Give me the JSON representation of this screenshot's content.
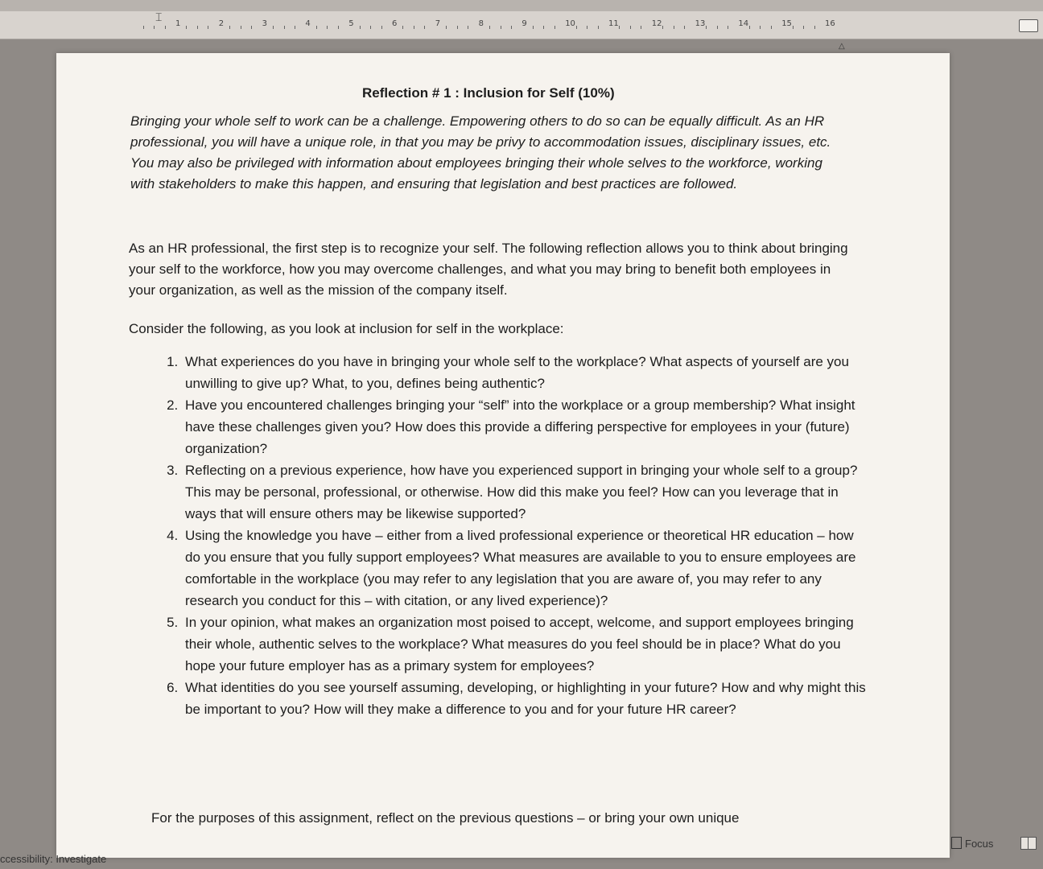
{
  "ruler": {
    "numbers": [
      "1",
      "2",
      "3",
      "4",
      "5",
      "6",
      "7",
      "8",
      "9",
      "10",
      "11",
      "12",
      "13",
      "14",
      "15",
      "16"
    ]
  },
  "document": {
    "title": "Reflection # 1 : Inclusion for Self (10%)",
    "intro_italic": "Bringing your whole self to work can be a challenge. Empowering others to do so can be equally difficult. As an HR professional, you will have a unique role, in that you may be privy to accommodation issues, disciplinary issues, etc. You may also be privileged with information about employees bringing their whole selves to the workforce, working with stakeholders to make this happen, and ensuring that legislation and best practices are followed.",
    "para1": "As an HR professional, the first step is to recognize your self. The following reflection allows you to think about bringing your self to the workforce, how you may overcome challenges, and what you may bring to benefit both employees in your organization, as well as the mission of the company itself.",
    "para2": "Consider the following, as you look at inclusion for self in the workplace:",
    "questions": [
      "What experiences do you have in bringing your whole self to the workplace? What aspects of yourself are you unwilling to give up? What, to you, defines being authentic?",
      "Have you encountered challenges bringing your “self” into the workplace or a group membership? What insight have these challenges given you? How does this provide a differing perspective for employees in your (future) organization?",
      "Reflecting on a previous experience, how have you experienced support in bringing your whole self to a group? This may be personal, professional, or otherwise. How did this make you feel? How can you leverage that in ways that will ensure others may be likewise supported?",
      "Using the knowledge you have – either from a lived professional experience or theoretical HR education – how do you ensure that you fully support employees? What measures are available to you to ensure employees are comfortable in the workplace (you may refer to any legislation that you are aware of, you may refer to any research you conduct for this – with citation, or any lived experience)?",
      "In your opinion, what makes an organization most poised to accept, welcome, and support employees bringing their whole, authentic selves to the workplace? What measures do you feel should be in place? What do you hope your future employer has as a primary system for employees?",
      "What identities do you see yourself assuming, developing, or highlighting in your future? How and why might this be important to you? How will they make a difference to you and for your future HR career?"
    ],
    "closing": "For the purposes of this assignment, reflect on the previous questions – or bring your own unique"
  },
  "statusbar": {
    "accessibility": "ccessibility: Investigate",
    "focus": "Focus"
  }
}
